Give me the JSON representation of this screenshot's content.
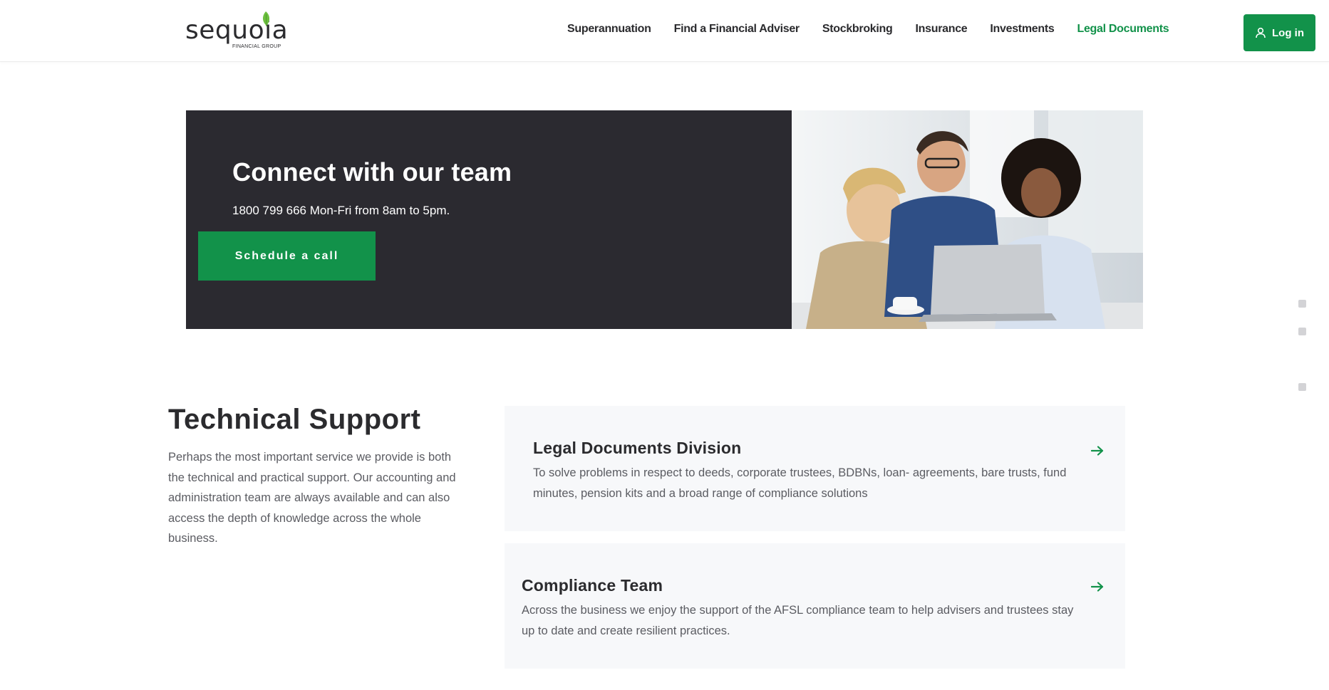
{
  "header": {
    "logo": {
      "word": "sequoia",
      "sub": "FINANCIAL GROUP"
    },
    "nav": [
      {
        "label": "Superannuation"
      },
      {
        "label": "Find a Financial Adviser"
      },
      {
        "label": "Stockbroking"
      },
      {
        "label": "Insurance"
      },
      {
        "label": "Investments"
      },
      {
        "label": "Legal Documents",
        "active": true
      }
    ],
    "login_label": "Log in"
  },
  "hero": {
    "title": "Connect with our team",
    "subtitle": "1800 799 666 Mon-Fri from 8am to 5pm.",
    "cta_label": "Schedule a call"
  },
  "support": {
    "title": "Technical Support",
    "body": "Perhaps the most important service we provide is both the technical and practical support. Our accounting and administration team are always available and can also access the depth of knowledge across the whole business."
  },
  "cards": [
    {
      "title": "Legal Documents Division",
      "body": "To solve problems in respect to deeds, corporate trustees, BDBNs, loan- agreements, bare trusts, fund minutes, pension kits and a broad range of compliance solutions"
    },
    {
      "title": "Compliance Team",
      "body": "Across the business we enjoy the support of the AFSL compliance team to help advisers and trustees stay up to date and create resilient practices."
    }
  ],
  "colors": {
    "brand_green": "#12924a",
    "dark_panel": "#2b2a30",
    "card_bg": "#f7f8fa",
    "text_dark": "#2b2b2e",
    "text_body": "#5b5c62"
  }
}
